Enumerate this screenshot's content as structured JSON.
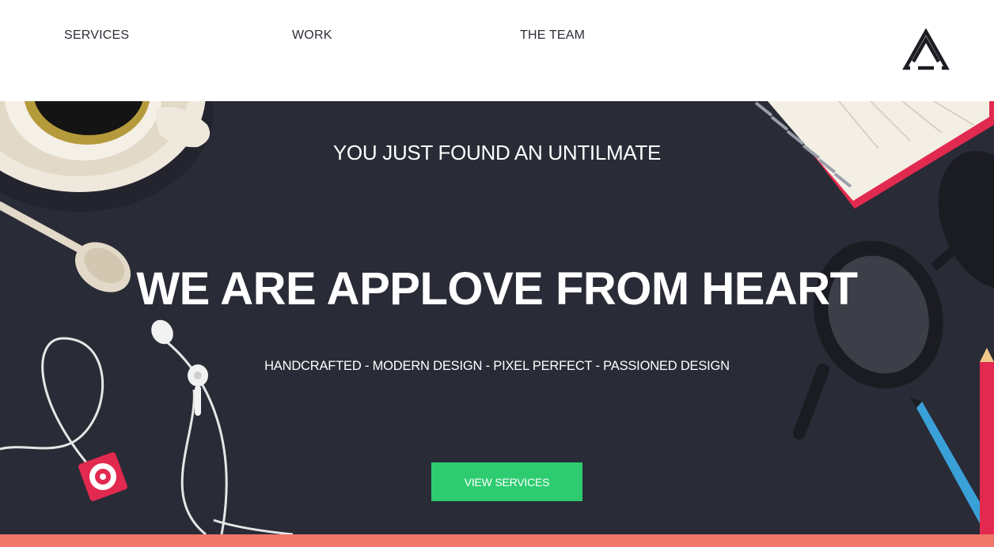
{
  "nav": {
    "items": [
      {
        "label": "SERVICES"
      },
      {
        "label": "WORK"
      },
      {
        "label": "THE TEAM"
      }
    ],
    "logo_icon": "triangle-logo-icon"
  },
  "hero": {
    "eyebrow": "YOU JUST FOUND AN UNTILMATE",
    "headline": "WE ARE APPLOVE FROM HEART",
    "tagline": "HANDCRAFTED - MODERN DESIGN - PIXEL PERFECT - PASSIONED DESIGN",
    "cta_label": "VIEW SERVICES"
  },
  "colors": {
    "hero_bg": "#292b36",
    "cta": "#2ecc71",
    "accent_strip": "#f0776a",
    "nav_text": "#2b2e37"
  },
  "icons": [
    "coffee-cup-icon",
    "spoon-icon",
    "earphones-icon",
    "music-player-icon",
    "notebook-icon",
    "glasses-icon",
    "pencil-icon"
  ]
}
